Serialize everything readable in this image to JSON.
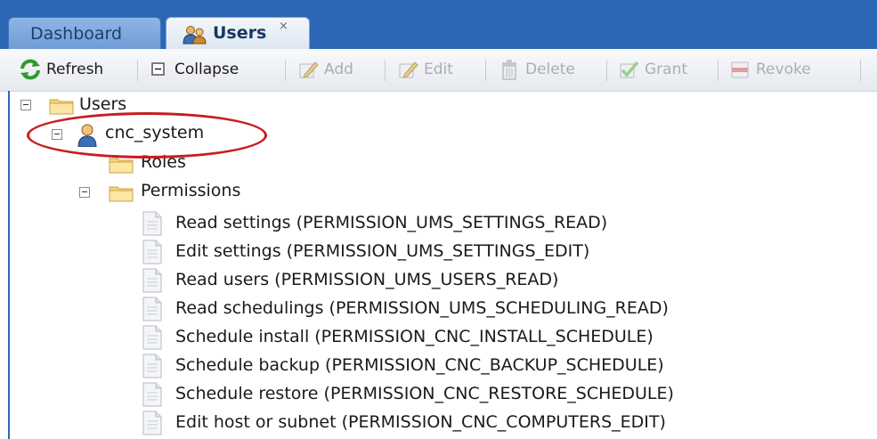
{
  "tabs": {
    "dashboard": "Dashboard",
    "users": "Users",
    "close_glyph": "×"
  },
  "toolbar": {
    "refresh": "Refresh",
    "collapse": "Collapse",
    "add": "Add",
    "edit": "Edit",
    "delete": "Delete",
    "grant": "Grant",
    "revoke": "Revoke"
  },
  "tree": {
    "root": "Users",
    "user": "cnc_system",
    "roles": "Roles",
    "permissions": "Permissions",
    "permission_items": [
      "Read settings (PERMISSION_UMS_SETTINGS_READ)",
      "Edit settings (PERMISSION_UMS_SETTINGS_EDIT)",
      "Read users (PERMISSION_UMS_USERS_READ)",
      "Read schedulings (PERMISSION_UMS_SCHEDULING_READ)",
      "Schedule install (PERMISSION_CNC_INSTALL_SCHEDULE)",
      "Schedule backup (PERMISSION_CNC_BACKUP_SCHEDULE)",
      "Schedule restore (PERMISSION_CNC_RESTORE_SCHEDULE)",
      "Edit host or subnet (PERMISSION_CNC_COMPUTERS_EDIT)"
    ]
  },
  "colors": {
    "tab_strip": "#2c67b5",
    "highlight": "#c81d1d"
  }
}
